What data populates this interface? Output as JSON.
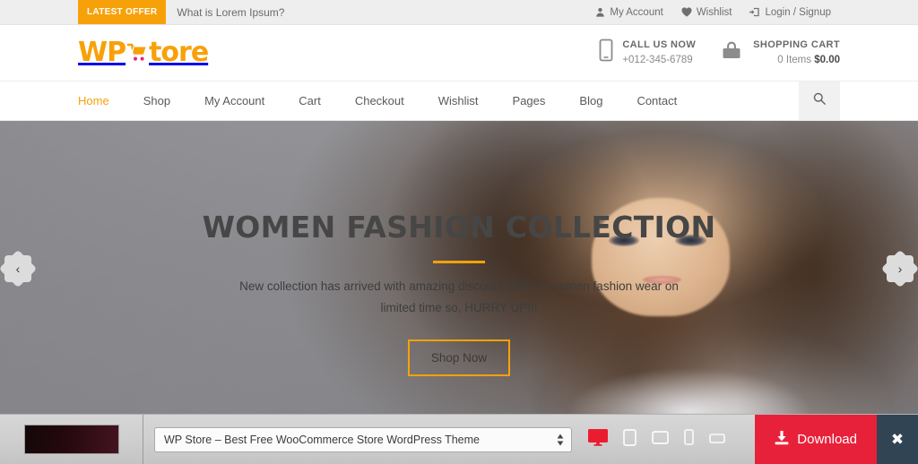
{
  "topbar": {
    "offer_badge": "LATEST OFFER",
    "offer_text": "What is Lorem Ipsum?",
    "links": [
      {
        "label": "My Account",
        "icon": "user-icon"
      },
      {
        "label": "Wishlist",
        "icon": "heart-icon"
      },
      {
        "label": "Login / Signup",
        "icon": "login-icon"
      }
    ]
  },
  "header": {
    "logo_wp": "WP",
    "logo_store": "tore",
    "call": {
      "title": "CALL US NOW",
      "phone": "+012-345-6789",
      "icon": "mobile-phone-icon"
    },
    "cart": {
      "title": "SHOPPING CART",
      "items": "0 Items",
      "amount": "$0.00",
      "icon": "shopping-bag-icon"
    }
  },
  "nav": {
    "items": [
      {
        "label": "Home",
        "active": true
      },
      {
        "label": "Shop",
        "active": false
      },
      {
        "label": "My Account",
        "active": false
      },
      {
        "label": "Cart",
        "active": false
      },
      {
        "label": "Checkout",
        "active": false
      },
      {
        "label": "Wishlist",
        "active": false
      },
      {
        "label": "Pages",
        "active": false
      },
      {
        "label": "Blog",
        "active": false
      },
      {
        "label": "Contact",
        "active": false
      }
    ],
    "search_icon": "search-icon"
  },
  "hero": {
    "title": "WOMEN FASHION COLLECTION",
    "subtitle": "New collection has arrived with amazing discount offer on women fashion wear on limited time so, HURRY UP!!!",
    "button": "Shop Now",
    "prev_arrow": "‹",
    "next_arrow": "›",
    "accent_color": "#f7a10a"
  },
  "preview_bar": {
    "theme_select": "WP Store – Best Free WooCommerce Store WordPress Theme",
    "devices": [
      {
        "name": "desktop",
        "active": true
      },
      {
        "name": "tablet-portrait",
        "active": false
      },
      {
        "name": "tablet-landscape",
        "active": false
      },
      {
        "name": "mobile-portrait",
        "active": false
      },
      {
        "name": "mobile-landscape",
        "active": false
      }
    ],
    "download_label": "Download",
    "close_label": "✖",
    "download_color": "#e8213a",
    "close_color": "#314453"
  }
}
